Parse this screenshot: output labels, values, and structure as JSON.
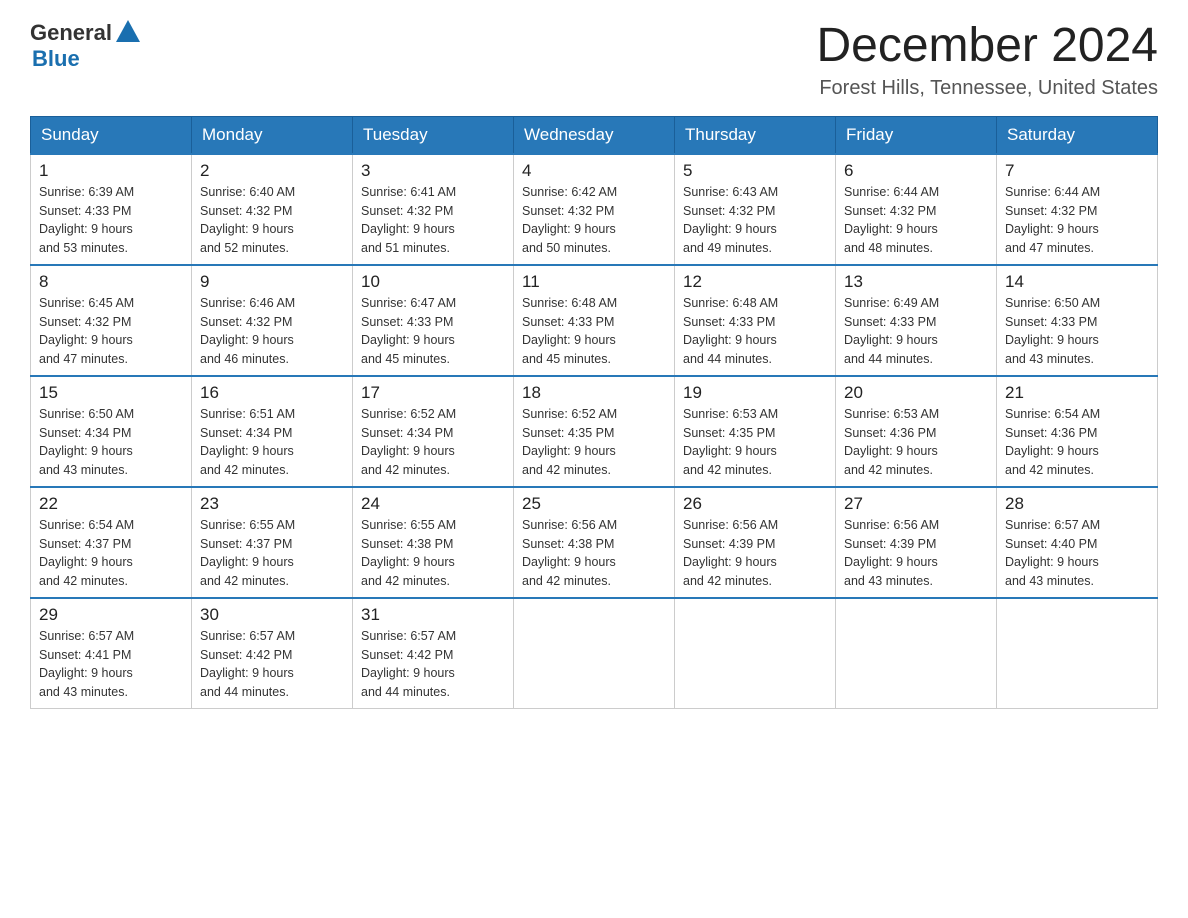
{
  "header": {
    "logo_general": "General",
    "logo_blue": "Blue",
    "title": "December 2024",
    "subtitle": "Forest Hills, Tennessee, United States"
  },
  "weekdays": [
    "Sunday",
    "Monday",
    "Tuesday",
    "Wednesday",
    "Thursday",
    "Friday",
    "Saturday"
  ],
  "weeks": [
    [
      {
        "day": "1",
        "sunrise": "6:39 AM",
        "sunset": "4:33 PM",
        "daylight": "9 hours and 53 minutes."
      },
      {
        "day": "2",
        "sunrise": "6:40 AM",
        "sunset": "4:32 PM",
        "daylight": "9 hours and 52 minutes."
      },
      {
        "day": "3",
        "sunrise": "6:41 AM",
        "sunset": "4:32 PM",
        "daylight": "9 hours and 51 minutes."
      },
      {
        "day": "4",
        "sunrise": "6:42 AM",
        "sunset": "4:32 PM",
        "daylight": "9 hours and 50 minutes."
      },
      {
        "day": "5",
        "sunrise": "6:43 AM",
        "sunset": "4:32 PM",
        "daylight": "9 hours and 49 minutes."
      },
      {
        "day": "6",
        "sunrise": "6:44 AM",
        "sunset": "4:32 PM",
        "daylight": "9 hours and 48 minutes."
      },
      {
        "day": "7",
        "sunrise": "6:44 AM",
        "sunset": "4:32 PM",
        "daylight": "9 hours and 47 minutes."
      }
    ],
    [
      {
        "day": "8",
        "sunrise": "6:45 AM",
        "sunset": "4:32 PM",
        "daylight": "9 hours and 47 minutes."
      },
      {
        "day": "9",
        "sunrise": "6:46 AM",
        "sunset": "4:32 PM",
        "daylight": "9 hours and 46 minutes."
      },
      {
        "day": "10",
        "sunrise": "6:47 AM",
        "sunset": "4:33 PM",
        "daylight": "9 hours and 45 minutes."
      },
      {
        "day": "11",
        "sunrise": "6:48 AM",
        "sunset": "4:33 PM",
        "daylight": "9 hours and 45 minutes."
      },
      {
        "day": "12",
        "sunrise": "6:48 AM",
        "sunset": "4:33 PM",
        "daylight": "9 hours and 44 minutes."
      },
      {
        "day": "13",
        "sunrise": "6:49 AM",
        "sunset": "4:33 PM",
        "daylight": "9 hours and 44 minutes."
      },
      {
        "day": "14",
        "sunrise": "6:50 AM",
        "sunset": "4:33 PM",
        "daylight": "9 hours and 43 minutes."
      }
    ],
    [
      {
        "day": "15",
        "sunrise": "6:50 AM",
        "sunset": "4:34 PM",
        "daylight": "9 hours and 43 minutes."
      },
      {
        "day": "16",
        "sunrise": "6:51 AM",
        "sunset": "4:34 PM",
        "daylight": "9 hours and 42 minutes."
      },
      {
        "day": "17",
        "sunrise": "6:52 AM",
        "sunset": "4:34 PM",
        "daylight": "9 hours and 42 minutes."
      },
      {
        "day": "18",
        "sunrise": "6:52 AM",
        "sunset": "4:35 PM",
        "daylight": "9 hours and 42 minutes."
      },
      {
        "day": "19",
        "sunrise": "6:53 AM",
        "sunset": "4:35 PM",
        "daylight": "9 hours and 42 minutes."
      },
      {
        "day": "20",
        "sunrise": "6:53 AM",
        "sunset": "4:36 PM",
        "daylight": "9 hours and 42 minutes."
      },
      {
        "day": "21",
        "sunrise": "6:54 AM",
        "sunset": "4:36 PM",
        "daylight": "9 hours and 42 minutes."
      }
    ],
    [
      {
        "day": "22",
        "sunrise": "6:54 AM",
        "sunset": "4:37 PM",
        "daylight": "9 hours and 42 minutes."
      },
      {
        "day": "23",
        "sunrise": "6:55 AM",
        "sunset": "4:37 PM",
        "daylight": "9 hours and 42 minutes."
      },
      {
        "day": "24",
        "sunrise": "6:55 AM",
        "sunset": "4:38 PM",
        "daylight": "9 hours and 42 minutes."
      },
      {
        "day": "25",
        "sunrise": "6:56 AM",
        "sunset": "4:38 PM",
        "daylight": "9 hours and 42 minutes."
      },
      {
        "day": "26",
        "sunrise": "6:56 AM",
        "sunset": "4:39 PM",
        "daylight": "9 hours and 42 minutes."
      },
      {
        "day": "27",
        "sunrise": "6:56 AM",
        "sunset": "4:39 PM",
        "daylight": "9 hours and 43 minutes."
      },
      {
        "day": "28",
        "sunrise": "6:57 AM",
        "sunset": "4:40 PM",
        "daylight": "9 hours and 43 minutes."
      }
    ],
    [
      {
        "day": "29",
        "sunrise": "6:57 AM",
        "sunset": "4:41 PM",
        "daylight": "9 hours and 43 minutes."
      },
      {
        "day": "30",
        "sunrise": "6:57 AM",
        "sunset": "4:42 PM",
        "daylight": "9 hours and 44 minutes."
      },
      {
        "day": "31",
        "sunrise": "6:57 AM",
        "sunset": "4:42 PM",
        "daylight": "9 hours and 44 minutes."
      },
      null,
      null,
      null,
      null
    ]
  ],
  "labels": {
    "sunrise": "Sunrise:",
    "sunset": "Sunset:",
    "daylight": "Daylight:"
  }
}
